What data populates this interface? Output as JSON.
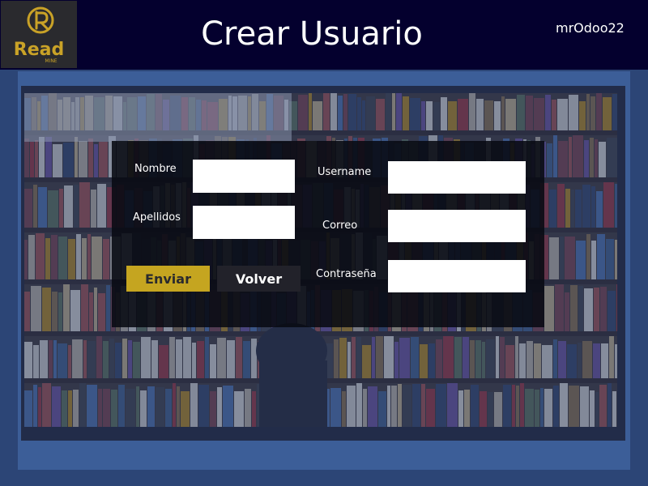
{
  "header": {
    "title": "Crear Usuario",
    "username": "mrOdoo22",
    "logo": {
      "icon": "read-mine-logo",
      "text": "Read",
      "subtext": "MINE",
      "color": "#c9a227"
    }
  },
  "form": {
    "nombre": {
      "label": "Nombre",
      "value": ""
    },
    "apellidos": {
      "label": "Apellidos",
      "value": ""
    },
    "username": {
      "label": "Username",
      "value": ""
    },
    "correo": {
      "label": "Correo",
      "value": ""
    },
    "contrasena": {
      "label": "Contraseña",
      "value": ""
    },
    "enviar_label": "Enviar",
    "volver_label": "Volver"
  },
  "colors": {
    "header_bg": "#04002e",
    "page_bg": "#2c4576",
    "frame_bg": "#3c5e98",
    "enviar_button": "#c5a520",
    "volver_button": "#22222a"
  },
  "background_image": "library-bookshelves-photo"
}
